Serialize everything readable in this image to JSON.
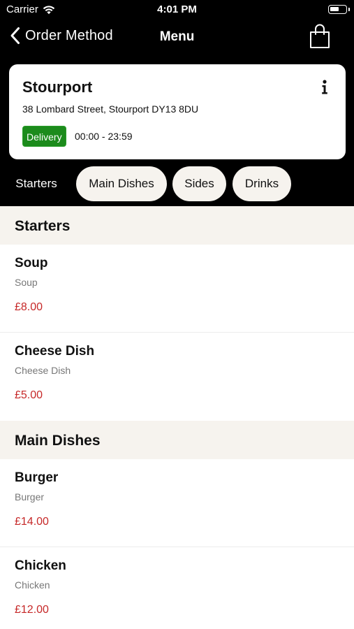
{
  "status_bar": {
    "carrier": "Carrier",
    "time": "4:01 PM"
  },
  "nav": {
    "back_label": "Order Method",
    "title": "Menu",
    "cart_icon": "shopping-bag-icon"
  },
  "store": {
    "name": "Stourport",
    "address": "38 Lombard Street, Stourport DY13 8DU",
    "badge": "Delivery",
    "badge_color": "#1c8b1c",
    "hours": "00:00 - 23:59"
  },
  "tabs": [
    "Starters",
    "Main Dishes",
    "Sides",
    "Drinks"
  ],
  "active_tab": "Starters",
  "colors": {
    "header_bg": "#000000",
    "section_bg": "#f6f3ee",
    "price": "#c62828"
  },
  "sections": [
    {
      "title": "Starters",
      "items": [
        {
          "name": "Soup",
          "description": "Soup",
          "price": "£8.00"
        },
        {
          "name": "Cheese Dish",
          "description": "Cheese Dish",
          "price": "£5.00"
        }
      ]
    },
    {
      "title": "Main Dishes",
      "items": [
        {
          "name": "Burger",
          "description": "Burger",
          "price": "£14.00"
        },
        {
          "name": "Chicken",
          "description": "Chicken",
          "price": "£12.00"
        }
      ]
    }
  ]
}
